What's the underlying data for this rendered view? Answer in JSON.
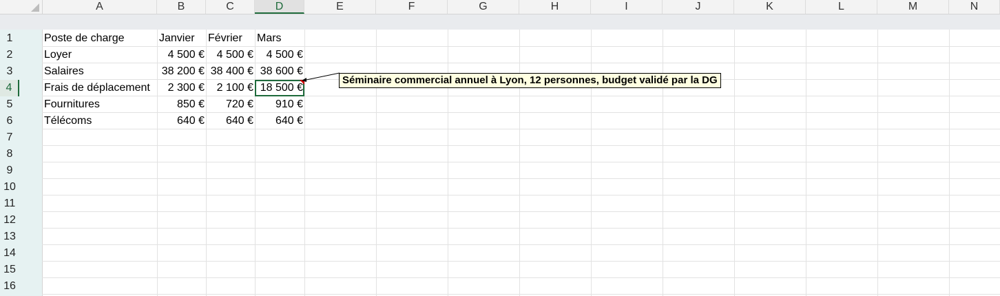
{
  "columns": [
    "A",
    "B",
    "C",
    "D",
    "E",
    "F",
    "G",
    "H",
    "I",
    "J",
    "K",
    "L",
    "M",
    "N"
  ],
  "rows": [
    "1",
    "2",
    "3",
    "4",
    "5",
    "6",
    "7",
    "8",
    "9",
    "10",
    "11",
    "12",
    "13",
    "14",
    "15",
    "16"
  ],
  "table": {
    "header": [
      "Poste de charge",
      "Janvier",
      "Février",
      "Mars"
    ],
    "rows": [
      [
        "Loyer",
        "4 500 €",
        "4 500 €",
        "4 500 €"
      ],
      [
        "Salaires",
        "38 200 €",
        "38 400 €",
        "38 600 €"
      ],
      [
        "Frais de déplacement",
        "2 300 €",
        "2 100 €",
        "18 500 €"
      ],
      [
        "Fournitures",
        "850 €",
        "720 €",
        "910 €"
      ],
      [
        "Télécoms",
        "640 €",
        "640 €",
        "640 €"
      ]
    ]
  },
  "active_cell": "D4",
  "comment": {
    "text": "Séminaire commercial annuel à Lyon, 12 personnes, budget validé par la DG"
  },
  "colors": {
    "accent": "#1e6a3b",
    "comment_bg": "#ffffe1",
    "note_indicator": "#d00000"
  }
}
